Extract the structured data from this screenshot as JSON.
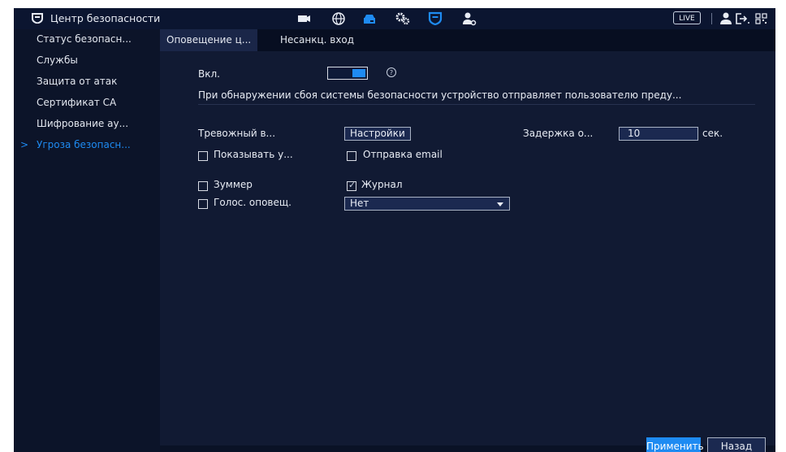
{
  "app": {
    "title": "Центр безопасности",
    "accent_color": "#1e8bf2"
  },
  "topbar": {
    "icons": [
      "security-shield-icon",
      "camera-icon",
      "network-globe-icon",
      "storage-icon",
      "settings-gears-icon",
      "security-icon",
      "account-icon"
    ],
    "live_label": "LIVE",
    "right_icons": [
      "user-icon",
      "logout-icon",
      "qr-code-icon"
    ]
  },
  "sidebar": {
    "items": [
      {
        "label": "Статус безопасн..."
      },
      {
        "label": "Службы"
      },
      {
        "label": "Защита от атак"
      },
      {
        "label": "Сертификат СА"
      },
      {
        "label": "Шифрование ау..."
      },
      {
        "label": "Угроза безопасн...",
        "active": true
      }
    ],
    "active_marker": ">"
  },
  "tabs": [
    {
      "label": "Оповещение ц...",
      "active": true
    },
    {
      "label": "Несанкц. вход"
    }
  ],
  "form": {
    "enable_label": "Вкл.",
    "enable_on": true,
    "help_symbol": "?",
    "description": "При обнаружении сбоя системы безопасности устройство отправляет пользователю преду...",
    "alarm_label": "Тревожный в...",
    "settings_button": "Настройки",
    "delay_label": "Задержка о...",
    "delay_value": "10",
    "delay_unit": "сек.",
    "show_label": "Показывать у...",
    "show_checked": false,
    "email_label": "Отправка email",
    "email_checked": false,
    "buzzer_label": "Зуммер",
    "buzzer_checked": false,
    "log_label": "Журнал",
    "log_checked": true,
    "voice_label": "Голос. оповещ.",
    "voice_checked": false,
    "voice_select_value": "Нет"
  },
  "footer": {
    "apply_label": "Применить",
    "back_label": "Назад"
  }
}
